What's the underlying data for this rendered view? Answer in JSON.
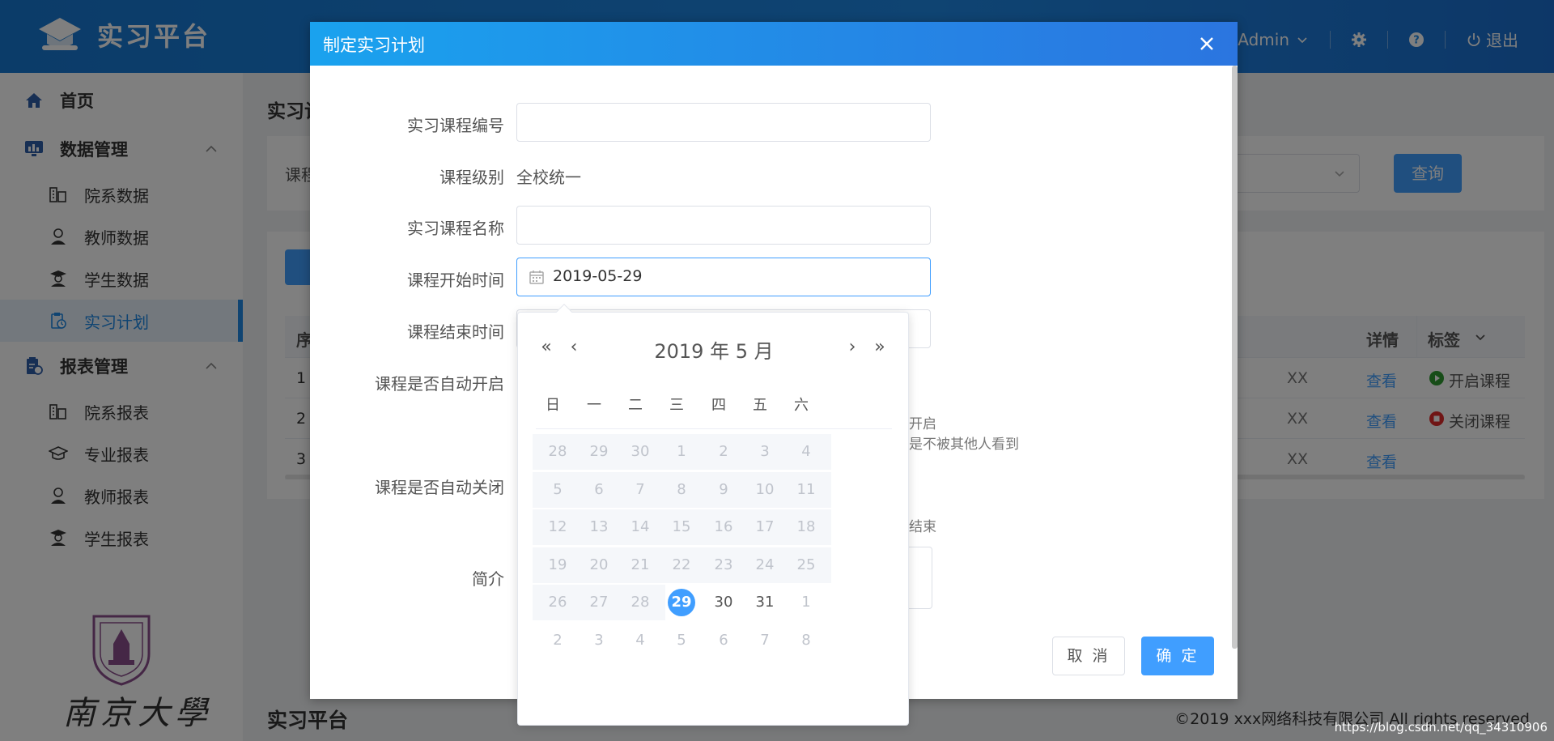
{
  "app": {
    "title": "实习平台"
  },
  "header": {
    "user": "Admin",
    "logout": "退出"
  },
  "sidebar": {
    "home": "首页",
    "data_mgmt": "数据管理",
    "dept_data": "院系数据",
    "teacher_data": "教师数据",
    "student_data": "学生数据",
    "plan": "实习计划",
    "report_mgmt": "报表管理",
    "dept_report": "院系报表",
    "major_report": "专业报表",
    "teacher_report": "教师报表",
    "student_report": "学生报表"
  },
  "page": {
    "title": "实习计",
    "filter_label": "课程",
    "query": "查询",
    "table": {
      "col_seq": "序",
      "col_detail": "详情",
      "col_tag": "标签",
      "rows": [
        {
          "seq": "1",
          "cut": "XX",
          "detail": "查看",
          "tag": "开启课程"
        },
        {
          "seq": "2",
          "cut": "XX",
          "detail": "查看",
          "tag": "关闭课程"
        },
        {
          "seq": "3",
          "cut": "XX",
          "detail": "查看",
          "tag": ""
        }
      ]
    },
    "footer_brand": "实习平台",
    "copyright": "©2019 xxx网络科技有限公司  All rights reserved",
    "watermark": "https://blog.csdn.net/qq_34310906"
  },
  "colors": {
    "primary": "#409eff",
    "header": "#1e88e5",
    "open": "#2e9a31",
    "close": "#e02a2a"
  },
  "dialog": {
    "title": "制定实习计划",
    "course_code_label": "实习课程编号",
    "course_level_label": "课程级别",
    "course_level_value": "全校统一",
    "course_name_label": "实习课程名称",
    "start_label": "课程开始时间",
    "start_value": "2019-05-29",
    "end_label": "课程结束时间",
    "auto_open_label": "课程是否自动开启",
    "auto_open_hint1": "开启",
    "auto_open_hint2": "是不被其他人看到",
    "auto_close_label": "课程是否自动关闭",
    "auto_close_hint": "结束",
    "intro_label": "简介",
    "cancel": "取 消",
    "ok": "确 定"
  },
  "picker": {
    "year_month": "2019 年  5 月",
    "weekdays": [
      "日",
      "一",
      "二",
      "三",
      "四",
      "五",
      "六"
    ],
    "weeks": [
      [
        "28",
        "29",
        "30",
        "1",
        "2",
        "3",
        "4"
      ],
      [
        "5",
        "6",
        "7",
        "8",
        "9",
        "10",
        "11"
      ],
      [
        "12",
        "13",
        "14",
        "15",
        "16",
        "17",
        "18"
      ],
      [
        "19",
        "20",
        "21",
        "22",
        "23",
        "24",
        "25"
      ],
      [
        "26",
        "27",
        "28",
        "29",
        "30",
        "31",
        "1"
      ],
      [
        "2",
        "3",
        "4",
        "5",
        "6",
        "7",
        "8"
      ]
    ],
    "selected": "29"
  }
}
